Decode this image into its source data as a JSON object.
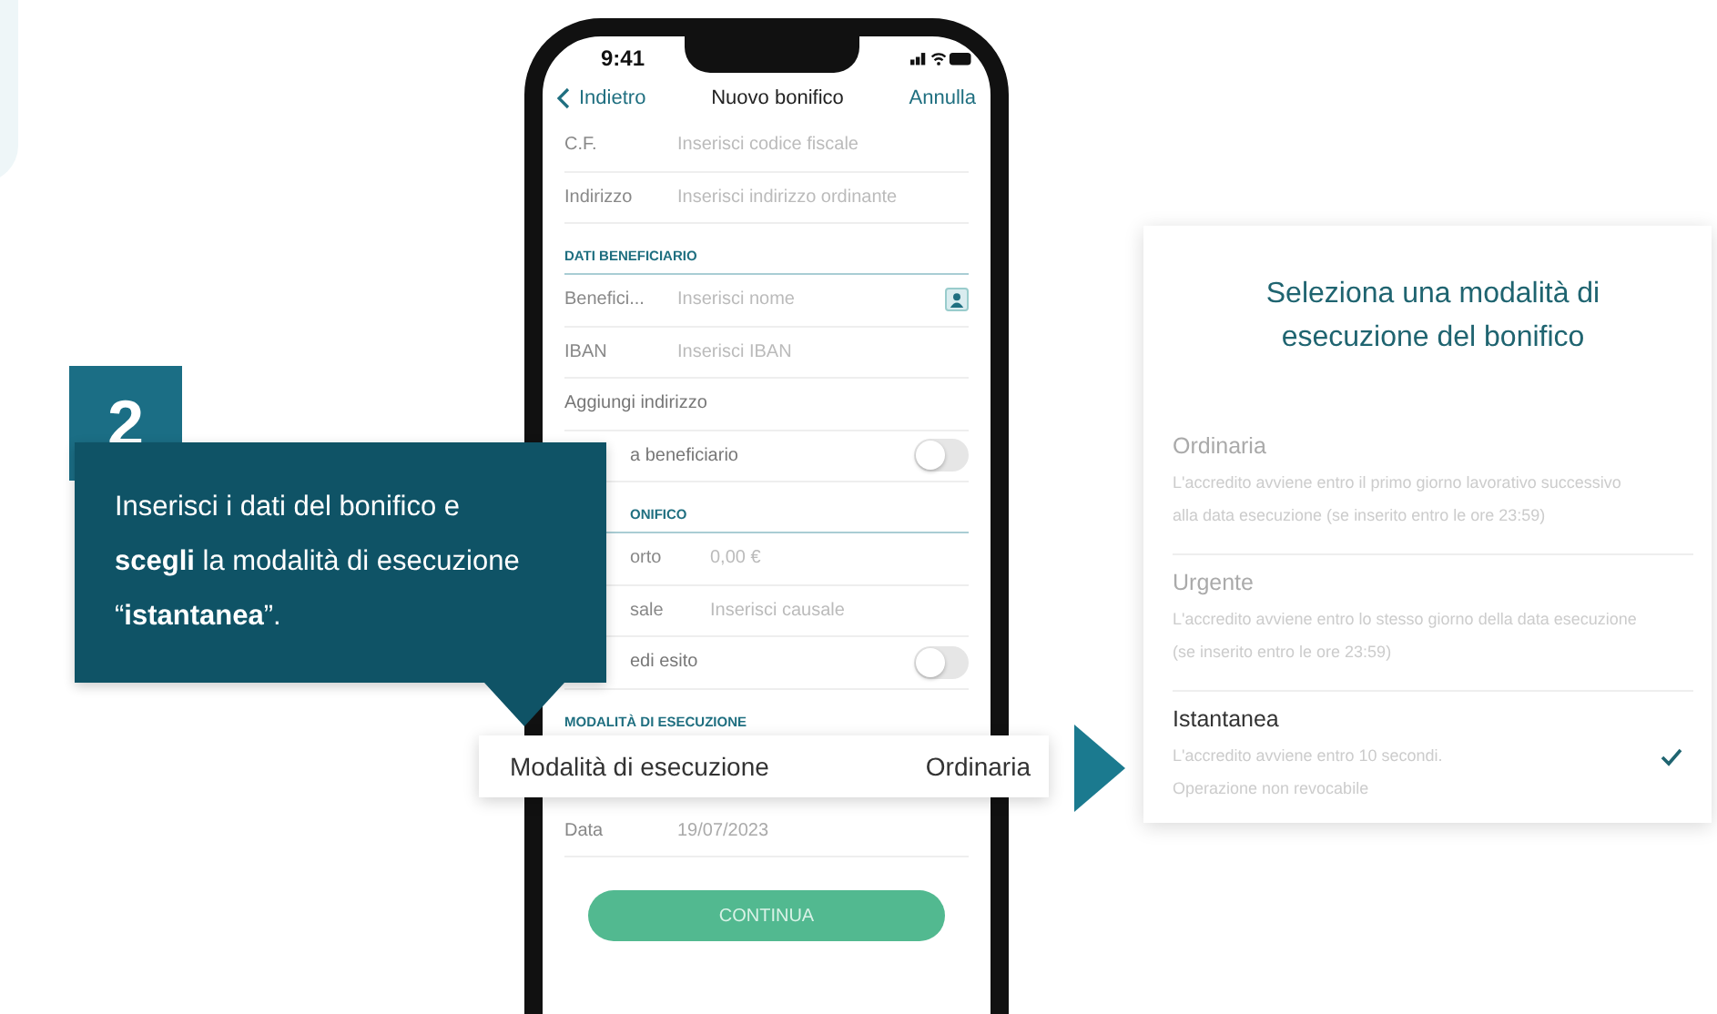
{
  "callout": {
    "step": "2",
    "text": "Inserisci i dati del bonifico e **scegli** la modalità di esecuzione “**istantanea**”."
  },
  "phone": {
    "status_bar": {
      "time": "9:41"
    },
    "nav": {
      "back": "Indietro",
      "title": "Nuovo bonifico",
      "action": "Annulla"
    },
    "rows": [
      {
        "kind": "field",
        "label": "C.F.",
        "placeholder": "Inserisci codice fiscale"
      },
      {
        "kind": "field",
        "label": "Indirizzo",
        "placeholder": "Inserisci indirizzo ordinante"
      },
      {
        "kind": "section",
        "label": "DATI BENEFICIARIO"
      },
      {
        "kind": "field",
        "label": "Benefici...",
        "placeholder": "Inserisci nome",
        "contact_button": true
      },
      {
        "kind": "field",
        "label": "IBAN",
        "placeholder": "Inserisci IBAN"
      },
      {
        "kind": "link",
        "label": "Aggiungi indirizzo"
      },
      {
        "kind": "toggle",
        "label": "a beneficiario",
        "on": false,
        "cut": true
      },
      {
        "kind": "section",
        "label": "ONIFICO",
        "cut": true
      },
      {
        "kind": "field",
        "label": "orto",
        "placeholder": "0,00 €",
        "cut": true
      },
      {
        "kind": "field",
        "label": "sale",
        "placeholder": "Inserisci causale",
        "cut": true
      },
      {
        "kind": "toggle",
        "label": "edi esito",
        "on": false,
        "cut": true
      },
      {
        "kind": "section",
        "label": "MODALITÀ DI ESECUZIONE"
      },
      {
        "kind": "hidden"
      },
      {
        "kind": "value",
        "label": "Data",
        "value": "19/07/2023"
      }
    ],
    "button": "CONTINUA"
  },
  "popup_row": {
    "label": "Modalità di esecuzione",
    "value": "Ordinaria"
  },
  "mode_card": {
    "title": "Seleziona una modalità di esecuzione del bonifico",
    "options": [
      {
        "title": "Ordinaria",
        "description": "L'accredito avviene entro il primo giorno lavorativo successivo alla data esecuzione (se inserito entro le ore 23:59)",
        "selected": false
      },
      {
        "title": "Urgente",
        "description": "L'accredito avviene entro lo stesso giorno della data esecuzione (se inserito entro le ore 23:59)",
        "selected": false
      },
      {
        "title": "Istantanea",
        "description": "L'accredito avviene entro 10 secondi.\nOperazione non revocabile",
        "selected": true
      }
    ]
  }
}
